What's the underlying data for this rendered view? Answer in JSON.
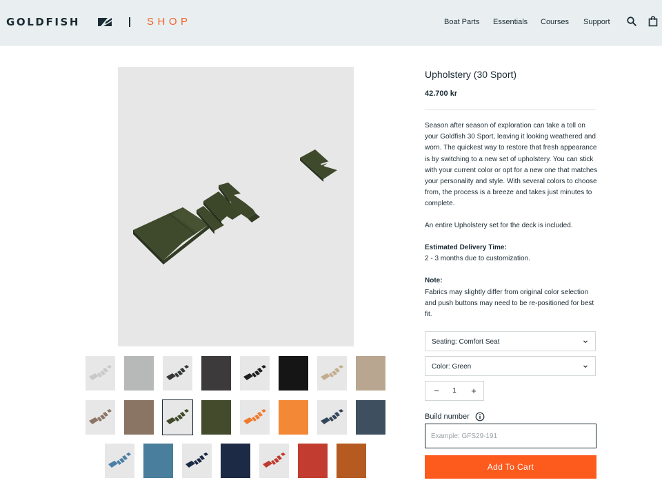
{
  "header": {
    "logo_text": "GOLDFISH",
    "shop_label": "SHOP",
    "nav": [
      "Boat Parts",
      "Essentials",
      "Courses",
      "Support"
    ],
    "icons": [
      "search-icon",
      "shopping-bag-icon"
    ]
  },
  "colors": {
    "accent": "#fd5a1e",
    "shop_orange": "#f0622a",
    "text": "#1b2b34",
    "header_bg": "#e9eff0"
  },
  "product": {
    "title": "Upholstery (30 Sport)",
    "price": "42.700 kr",
    "description": "Season after season of exploration can take a toll on your Goldfish 30 Sport, leaving it looking weathered and worn. The quickest way to restore that fresh appearance is by switching to a new set of upholstery. You can stick with your current color or opt for a new one that matches your personality and style. With several colors to choose from, the process is a breeze and takes just minutes to complete.",
    "included": "An entire Upholstery set for the deck is included.",
    "delivery_heading": "Estimated Delivery Time:",
    "delivery_text": "2 - 3 months due to customization.",
    "note_heading": "Note:",
    "note_text": "Fabrics may slightly differ from original color selection and push buttons may need to be re-positioned for best fit."
  },
  "options": {
    "seating": "Seating: Comfort Seat",
    "color": "Color: Green"
  },
  "quantity": {
    "minus": "−",
    "value": "1",
    "plus": "+"
  },
  "build": {
    "label": "Build number",
    "placeholder": "Example: GFS29-191"
  },
  "add_to_cart": "Add To Cart",
  "thumbnails": [
    {
      "kind": "set",
      "color": "#c7c9c7",
      "selected": false
    },
    {
      "kind": "swatch",
      "color": "#b7b8b8",
      "selected": false
    },
    {
      "kind": "set",
      "color": "#333836",
      "selected": false
    },
    {
      "kind": "swatch",
      "color": "#3d3a3b",
      "selected": false
    },
    {
      "kind": "set",
      "color": "#1e1e1e",
      "selected": false
    },
    {
      "kind": "swatch",
      "color": "#151515",
      "selected": false
    },
    {
      "kind": "set",
      "color": "#c4ad8e",
      "selected": false
    },
    {
      "kind": "swatch",
      "color": "#b9a690",
      "selected": false
    },
    {
      "kind": "set",
      "color": "#8c7565",
      "selected": false
    },
    {
      "kind": "swatch",
      "color": "#8a7463",
      "selected": false
    },
    {
      "kind": "set",
      "color": "#3f4a2a",
      "selected": true
    },
    {
      "kind": "swatch",
      "color": "#434b2c",
      "selected": false
    },
    {
      "kind": "set",
      "color": "#f07a2d",
      "selected": false
    },
    {
      "kind": "swatch",
      "color": "#f38936",
      "selected": false
    },
    {
      "kind": "set",
      "color": "#33465a",
      "selected": false
    },
    {
      "kind": "swatch",
      "color": "#3e5060",
      "selected": false
    },
    {
      "kind": "set",
      "color": "#4a7ea6",
      "selected": false
    },
    {
      "kind": "swatch",
      "color": "#4a7e9d",
      "selected": false
    },
    {
      "kind": "set",
      "color": "#1b2a44",
      "selected": false
    },
    {
      "kind": "swatch",
      "color": "#1d2a45",
      "selected": false
    },
    {
      "kind": "set",
      "color": "#bf3a2e",
      "selected": false
    },
    {
      "kind": "swatch",
      "color": "#c23d30",
      "selected": false
    },
    {
      "kind": "swatch",
      "color": "#b55a20",
      "selected": false
    }
  ]
}
